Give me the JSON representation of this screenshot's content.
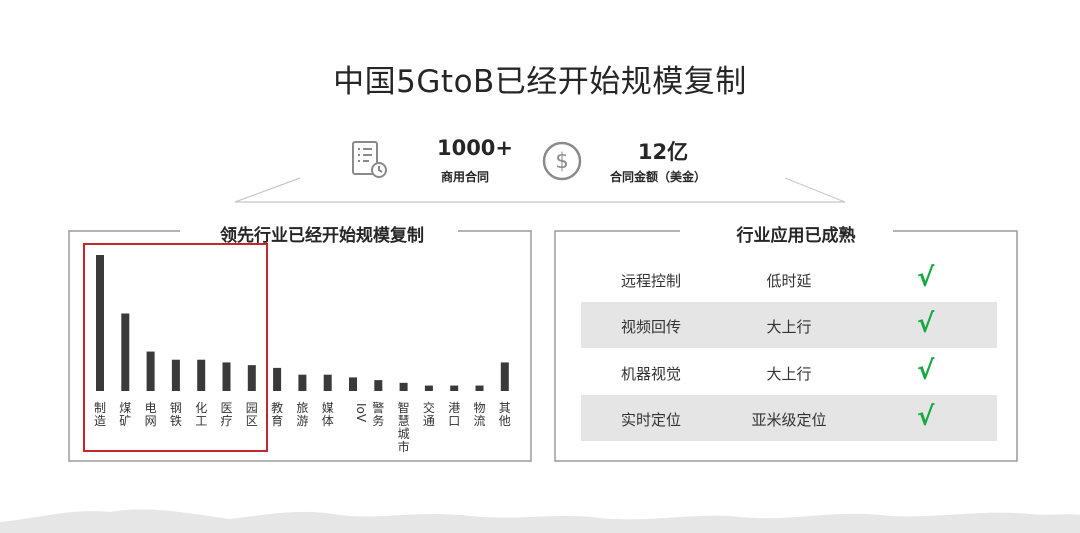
{
  "title": "中国5GtoB已经开始规模复制",
  "stats": [
    {
      "icon": "contract-list-icon",
      "value": "1000+",
      "label": "商用合同"
    },
    {
      "icon": "dollar-coin-icon",
      "value": "12亿",
      "label": "合同金额（美金）"
    }
  ],
  "left_panel": {
    "title": "领先行业已经开始规模复制"
  },
  "right_panel": {
    "title": "行业应用已成熟",
    "rows": [
      {
        "app": "远程控制",
        "feature": "低时延",
        "check": "√"
      },
      {
        "app": "视频回传",
        "feature": "大上行",
        "check": "√"
      },
      {
        "app": "机器视觉",
        "feature": "大上行",
        "check": "√"
      },
      {
        "app": "实时定位",
        "feature": "亚米级定位",
        "check": "√"
      }
    ]
  },
  "colors": {
    "bar": "#3a3a3a",
    "highlight": "#c2272d",
    "check": "#17a843",
    "row_shade": "#e5e5e5"
  },
  "chart_data": {
    "type": "bar",
    "title": "领先行业已经开始规模复制",
    "xlabel": "",
    "ylabel": "",
    "categories": [
      "制造",
      "煤矿",
      "电网",
      "钢铁",
      "化工",
      "医疗",
      "园区",
      "教育",
      "旅游",
      "媒体",
      "IoV",
      "警务",
      "智慧城市",
      "交通",
      "港口",
      "物流",
      "其他"
    ],
    "values": [
      100,
      57,
      29,
      23,
      23,
      21,
      19,
      17,
      12,
      12,
      10,
      8,
      6,
      4,
      4,
      4,
      21
    ],
    "ylim": [
      0,
      100
    ],
    "grid": false,
    "highlighted_categories": [
      "制造",
      "煤矿",
      "电网",
      "钢铁",
      "化工",
      "医疗",
      "园区"
    ]
  }
}
